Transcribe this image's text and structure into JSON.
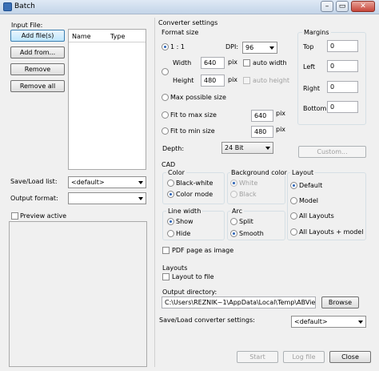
{
  "window": {
    "title": "Batch",
    "minimize_glyph": "–",
    "maximize_glyph": "▭",
    "close_glyph": "✕"
  },
  "left": {
    "input_file_label": "Input File:",
    "buttons": {
      "add_files": "Add file(s)",
      "add_from": "Add from...",
      "remove": "Remove",
      "remove_all": "Remove all"
    },
    "file_list_headers": {
      "name": "Name",
      "type": "Type"
    },
    "save_load_list_label": "Save/Load list:",
    "save_load_list_value": "<default>",
    "output_format_label": "Output format:",
    "output_format_value": "",
    "preview_active_label": "Preview active"
  },
  "converter": {
    "title": "Converter settings",
    "format_size_label": "Format size",
    "ratio_label": "1 : 1",
    "dpi_label": "DPI:",
    "dpi_value": "96",
    "width_label": "Width",
    "width_value": "640",
    "height_label": "Height",
    "height_value": "480",
    "pix": "pix",
    "auto_width_label": "auto width",
    "auto_height_label": "auto height",
    "max_possible_size_label": "Max possible size",
    "fit_to_max_label": "Fit to max size",
    "fit_to_max_value": "640",
    "fit_to_min_label": "Fit to min size",
    "fit_to_min_value": "480",
    "depth_label": "Depth:",
    "depth_value": "24 Bit",
    "margins_label": "Margins",
    "margin_top_label": "Top",
    "margin_left_label": "Left",
    "margin_right_label": "Right",
    "margin_bottom_label": "Bottom",
    "margin_top_value": "0",
    "margin_left_value": "0",
    "margin_right_value": "0",
    "margin_bottom_value": "0",
    "custom_button": "Custom..."
  },
  "cad": {
    "title": "CAD",
    "color_label": "Color",
    "black_white_label": "Black-white",
    "color_mode_label": "Color mode",
    "bg_color_label": "Background color",
    "white_label": "White",
    "black_label": "Black",
    "layout_label": "Layout",
    "default_label": "Default",
    "model_label": "Model",
    "all_layouts_label": "All Layouts",
    "all_layouts_model_label": "All Layouts + model",
    "line_width_label": "Line width",
    "show_label": "Show",
    "hide_label": "Hide",
    "arc_label": "Arc",
    "split_label": "Split",
    "smooth_label": "Smooth",
    "pdf_page_label": "PDF page as image"
  },
  "layouts": {
    "title": "Layouts",
    "layout_to_file_label": "Layout to file"
  },
  "output": {
    "directory_label": "Output directory:",
    "directory_value": "C:\\Users\\REZNIK~1\\AppData\\Local\\Temp\\ABViewer_",
    "browse_button": "Browse",
    "save_load_converter_label": "Save/Load converter settings:",
    "save_load_converter_value": "<default>"
  },
  "footer": {
    "start": "Start",
    "log_file": "Log file",
    "close": "Close"
  }
}
